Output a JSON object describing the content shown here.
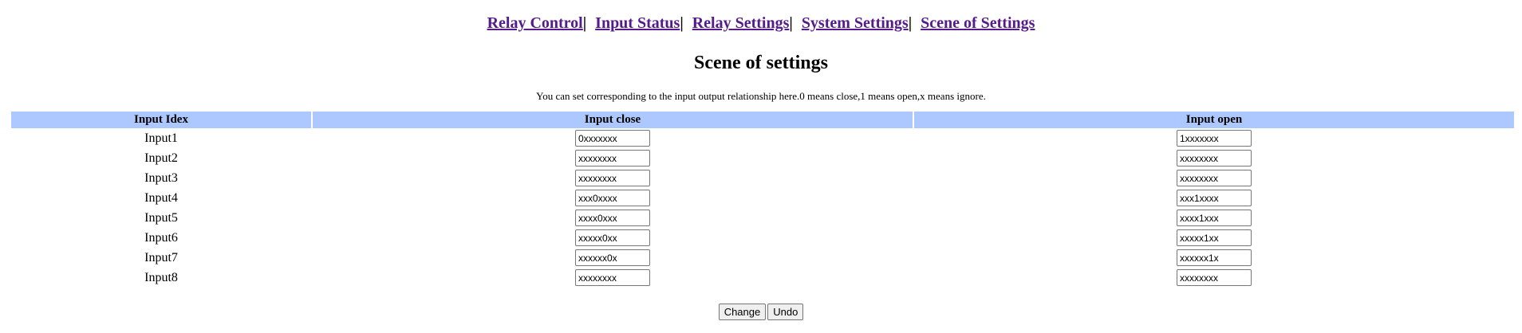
{
  "nav": {
    "items": [
      {
        "label": "Relay Control"
      },
      {
        "label": "Input Status"
      },
      {
        "label": "Relay Settings"
      },
      {
        "label": "System Settings"
      },
      {
        "label": "Scene of Settings"
      }
    ],
    "separator": "|"
  },
  "page": {
    "title": "Scene of settings",
    "description": "You can set corresponding to the input output relationship here.0 means close,1 means open,x means ignore."
  },
  "table": {
    "headers": [
      "Input Idex",
      "Input close",
      "Input open"
    ],
    "rows": [
      {
        "name": "Input1",
        "close": "0xxxxxxx",
        "open": "1xxxxxxx"
      },
      {
        "name": "Input2",
        "close": "xxxxxxxx",
        "open": "xxxxxxxx"
      },
      {
        "name": "Input3",
        "close": "xxxxxxxx",
        "open": "xxxxxxxx"
      },
      {
        "name": "Input4",
        "close": "xxx0xxxx",
        "open": "xxx1xxxx"
      },
      {
        "name": "Input5",
        "close": "xxxx0xxx",
        "open": "xxxx1xxx"
      },
      {
        "name": "Input6",
        "close": "xxxxx0xx",
        "open": "xxxxx1xx"
      },
      {
        "name": "Input7",
        "close": "xxxxxx0x",
        "open": "xxxxxx1x"
      },
      {
        "name": "Input8",
        "close": "xxxxxxxx",
        "open": "xxxxxxxx"
      }
    ]
  },
  "actions": {
    "change_label": "Change",
    "undo_label": "Undo"
  },
  "colors": {
    "header_bg": "#adc8ff",
    "link": "#551a8b"
  }
}
